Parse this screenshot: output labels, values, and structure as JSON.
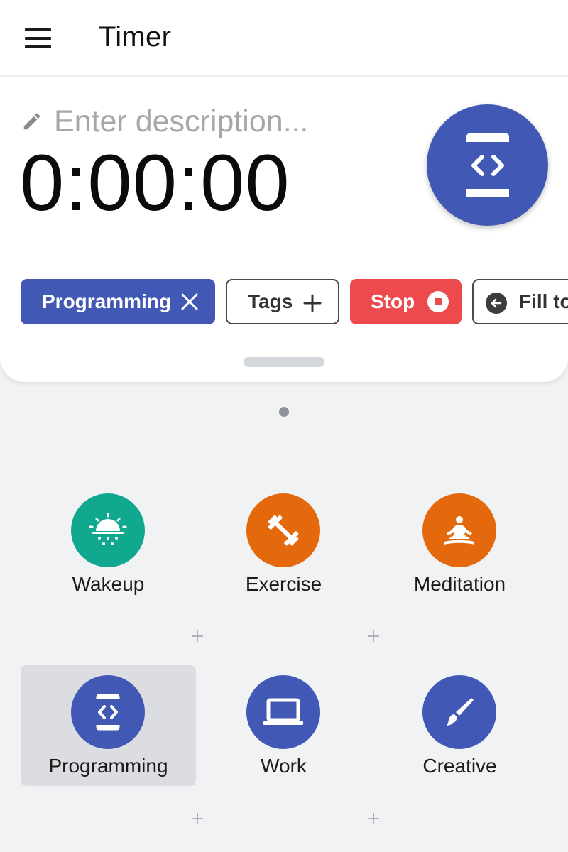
{
  "app": {
    "title": "Timer"
  },
  "timer": {
    "description_placeholder": "Enter description...",
    "elapsed": "0:00:00",
    "active_icon": "programming-icon",
    "accent": "#4258b5"
  },
  "chips": {
    "programming": "Programming",
    "tags": "Tags",
    "stop": "Stop",
    "fill": "Fill to"
  },
  "colors": {
    "primary": "#4258b5",
    "stop": "#ec4a4c",
    "teal": "#10a88f",
    "orange": "#e4690c"
  },
  "activities": [
    {
      "label": "Wakeup",
      "icon": "sunrise-icon",
      "color": "#10a88f",
      "selected": false
    },
    {
      "label": "Exercise",
      "icon": "dumbbell-icon",
      "color": "#e4690c",
      "selected": false
    },
    {
      "label": "Meditation",
      "icon": "meditation-icon",
      "color": "#e4690c",
      "selected": false
    },
    {
      "label": "Programming",
      "icon": "programming-icon",
      "color": "#4258b5",
      "selected": true
    },
    {
      "label": "Work",
      "icon": "laptop-icon",
      "color": "#4258b5",
      "selected": false
    },
    {
      "label": "Creative",
      "icon": "brush-icon",
      "color": "#4258b5",
      "selected": false
    }
  ]
}
